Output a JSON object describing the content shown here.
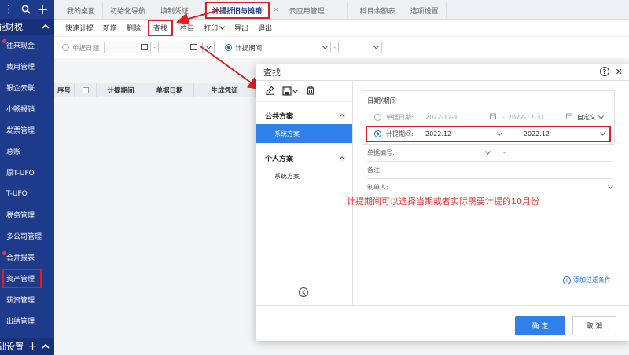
{
  "sidebar": {
    "top_left_icon": "⋮",
    "search_icon": "🔍",
    "add_icon": "+",
    "section_title": "能财税",
    "items": [
      {
        "label": "往来现金",
        "dot": true
      },
      {
        "label": "费用管理",
        "dot": false
      },
      {
        "label": "银企云联",
        "dot": false
      },
      {
        "label": "小畅报销",
        "dot": false
      },
      {
        "label": "发票管理",
        "dot": false
      },
      {
        "label": "总账",
        "dot": false
      },
      {
        "label": "原T-UFO",
        "dot": false
      },
      {
        "label": "T-UFO",
        "dot": false
      },
      {
        "label": "税务管理",
        "dot": false
      },
      {
        "label": "多公司管理",
        "dot": false
      },
      {
        "label": "合并报表",
        "dot": true
      },
      {
        "label": "资产管理",
        "dot": false
      },
      {
        "label": "薪资管理",
        "dot": false
      },
      {
        "label": "出纳管理",
        "dot": false
      }
    ],
    "bottom_title": "础设置"
  },
  "tabs": [
    {
      "label": "我的桌面"
    },
    {
      "label": "初始化导航"
    },
    {
      "label": "填制凭证"
    },
    {
      "label": "计提折旧与摊销"
    },
    {
      "label": "云应用管理"
    },
    {
      "label": "科目余额表"
    },
    {
      "label": "选项设置"
    }
  ],
  "toolbar": {
    "btn1": "快速计提",
    "btn2": "新增",
    "btn3": "删除",
    "btn4": "查找",
    "btn5": "栏目",
    "btn6": "打印",
    "btn7": "导出",
    "btn8": "退出"
  },
  "filter": {
    "doc_date_label": "单据日期",
    "period_label": "计提期间",
    "dash": "-"
  },
  "table": {
    "headers": [
      "序号",
      "",
      "计提期间",
      "单据日期",
      "生成凭证"
    ]
  },
  "dialog": {
    "title": "查找",
    "help_icon": "?",
    "close_icon": "✕",
    "public_group": "公共方案",
    "public_item": "系统方案",
    "private_group": "个人方案",
    "private_item": "系统方案",
    "date_section": "日期/期间",
    "doc_date_label": "单据日期:",
    "doc_date_from": "2022-12-1",
    "doc_date_to": "2022-12-31",
    "custom_label": "自定义",
    "period_label": "计提期间:",
    "period_from": "2022.12",
    "period_to": "2022.12",
    "doc_no_label": "单据编号:",
    "remark_label": "备注:",
    "maker_label": "制单人:",
    "dash": "-",
    "add_filter": "添加过滤条件",
    "ok": "确 定",
    "cancel": "取 消"
  },
  "annotation": "计提期间可以选择当期或者实际需要计提的10月份",
  "colors": {
    "sidebar": "#1e3a8a",
    "accent": "#2f80ed",
    "highlight": "#e02020"
  }
}
